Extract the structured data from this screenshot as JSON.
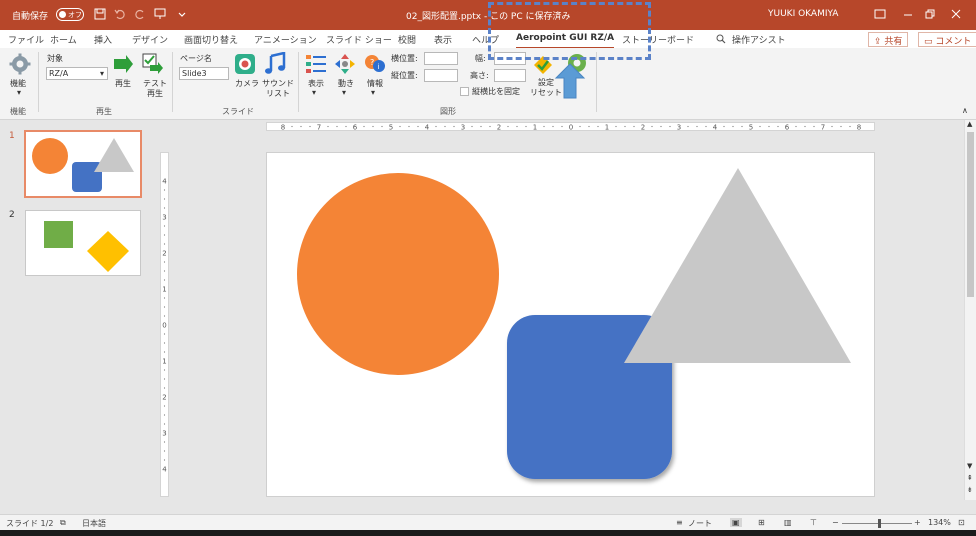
{
  "titlebar": {
    "autosave_label": "自動保存",
    "autosave_state": "オフ",
    "document_title": "02_図形配置.pptx - この PC に保存済み",
    "user_name": "YUUKI OKAMIYA"
  },
  "tabs": [
    {
      "label": "ファイル"
    },
    {
      "label": "ホーム"
    },
    {
      "label": "挿入"
    },
    {
      "label": "デザイン"
    },
    {
      "label": "画面切り替え"
    },
    {
      "label": "アニメーション"
    },
    {
      "label": "スライド ショー"
    },
    {
      "label": "校閲"
    },
    {
      "label": "表示"
    },
    {
      "label": "ヘルプ"
    },
    {
      "label": "Aeropoint GUI RZ/A"
    },
    {
      "label": "ストーリーボード"
    }
  ],
  "tell_me": "操作アシスト",
  "share_label": "共有",
  "comment_label": "コメント",
  "ribbon": {
    "func_label": "機能",
    "func_group": "機能",
    "target_label": "対象",
    "target_value": "RZ/A",
    "play_label": "再生",
    "test_play_label": "テスト\n再生",
    "play_group": "再生",
    "page_name_label": "ページ名",
    "page_name_value": "Slide3",
    "camera_label": "カメラ",
    "sound_list_label": "サウンド\nリスト",
    "slide_group": "スライド",
    "display_label": "表示",
    "motion_label": "動き",
    "info_label": "情報",
    "xpos_label": "横位置:",
    "ypos_label": "縦位置:",
    "width_label": "幅:",
    "height_label": "高さ:",
    "lock_aspect_label": "縦横比を固定",
    "settings_reset_label": "設定\nリセット",
    "shape_group": "図形"
  },
  "slides_pane": {
    "slide1_num": "1",
    "slide2_num": "2"
  },
  "ruler": {
    "h_ticks": [
      "8",
      "7",
      "6",
      "5",
      "4",
      "3",
      "2",
      "1",
      "0",
      "1",
      "2",
      "3",
      "4",
      "5",
      "6",
      "7",
      "8"
    ],
    "v_ticks": [
      "4",
      "3",
      "2",
      "1",
      "0",
      "1",
      "2",
      "3",
      "4"
    ]
  },
  "status": {
    "slide_info": "スライド 1/2",
    "language": "日本語",
    "notes_label": "ノート",
    "zoom": "134%"
  },
  "colors": {
    "titlebar_bg": "#b7472a",
    "circle": "#f48436",
    "rounded_square": "#4472c4",
    "triangle": "#c8c8c8",
    "green_square": "#70ad47",
    "diamond": "#ffc000",
    "annotation": "#5b82c8"
  }
}
